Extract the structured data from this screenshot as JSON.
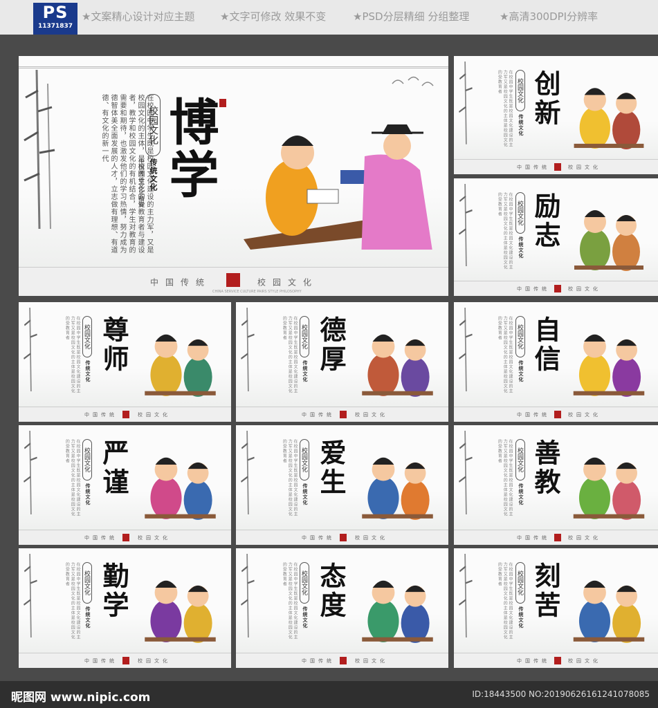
{
  "header": {
    "logo_text": "PS",
    "logo_number": "11371837",
    "features": [
      "★文案精心设计对应主题",
      "★文字可修改 效果不变",
      "★PSD分层精细 分组整理",
      "★高清300DPI分辨率"
    ]
  },
  "main_panel": {
    "title": "博学",
    "badge": "校园文化",
    "sub_badge": "传统文化",
    "sub_caption": "中国传统文化精粹",
    "body_text": "在校园中学生既是校园文化建设的主力军，又是校园文化的主体，是校园文化的受教育者与建设者，教学和校园文化的有机结合，学生对教育的需要和期待，也激发他们的学习热情，努力成为德智体美全面发展的人才，立志做有理想、有道德、有文化的新一代",
    "footer_left": "中国传统",
    "footer_right": "校园文化",
    "footer_small": "CHINA SERVICE CULTURE PAIRS STYLE PHILOSOPHY"
  },
  "panels": [
    {
      "title": "创新"
    },
    {
      "title": "励志"
    },
    {
      "title": "尊师"
    },
    {
      "title": "德厚"
    },
    {
      "title": "自信"
    },
    {
      "title": "严谨"
    },
    {
      "title": "爱生"
    },
    {
      "title": "善教"
    },
    {
      "title": "勤学"
    },
    {
      "title": "态度"
    },
    {
      "title": "刻苦"
    }
  ],
  "panel_common": {
    "badge": "校园文化",
    "sub_badge": "传统文化",
    "footer_left": "中国传统",
    "footer_right": "校园文化",
    "body_text": "在校园中学生既是校园文化建设的主力军又是校园文化的主体是校园文化的受教育者"
  },
  "watermark": {
    "site": "昵图网 www.nipic.com",
    "id_text": "ID:18443500 NO:20190626161241078085"
  },
  "colors": {
    "accent_red": "#b21e1e",
    "ps_blue": "#1a3a8c"
  }
}
